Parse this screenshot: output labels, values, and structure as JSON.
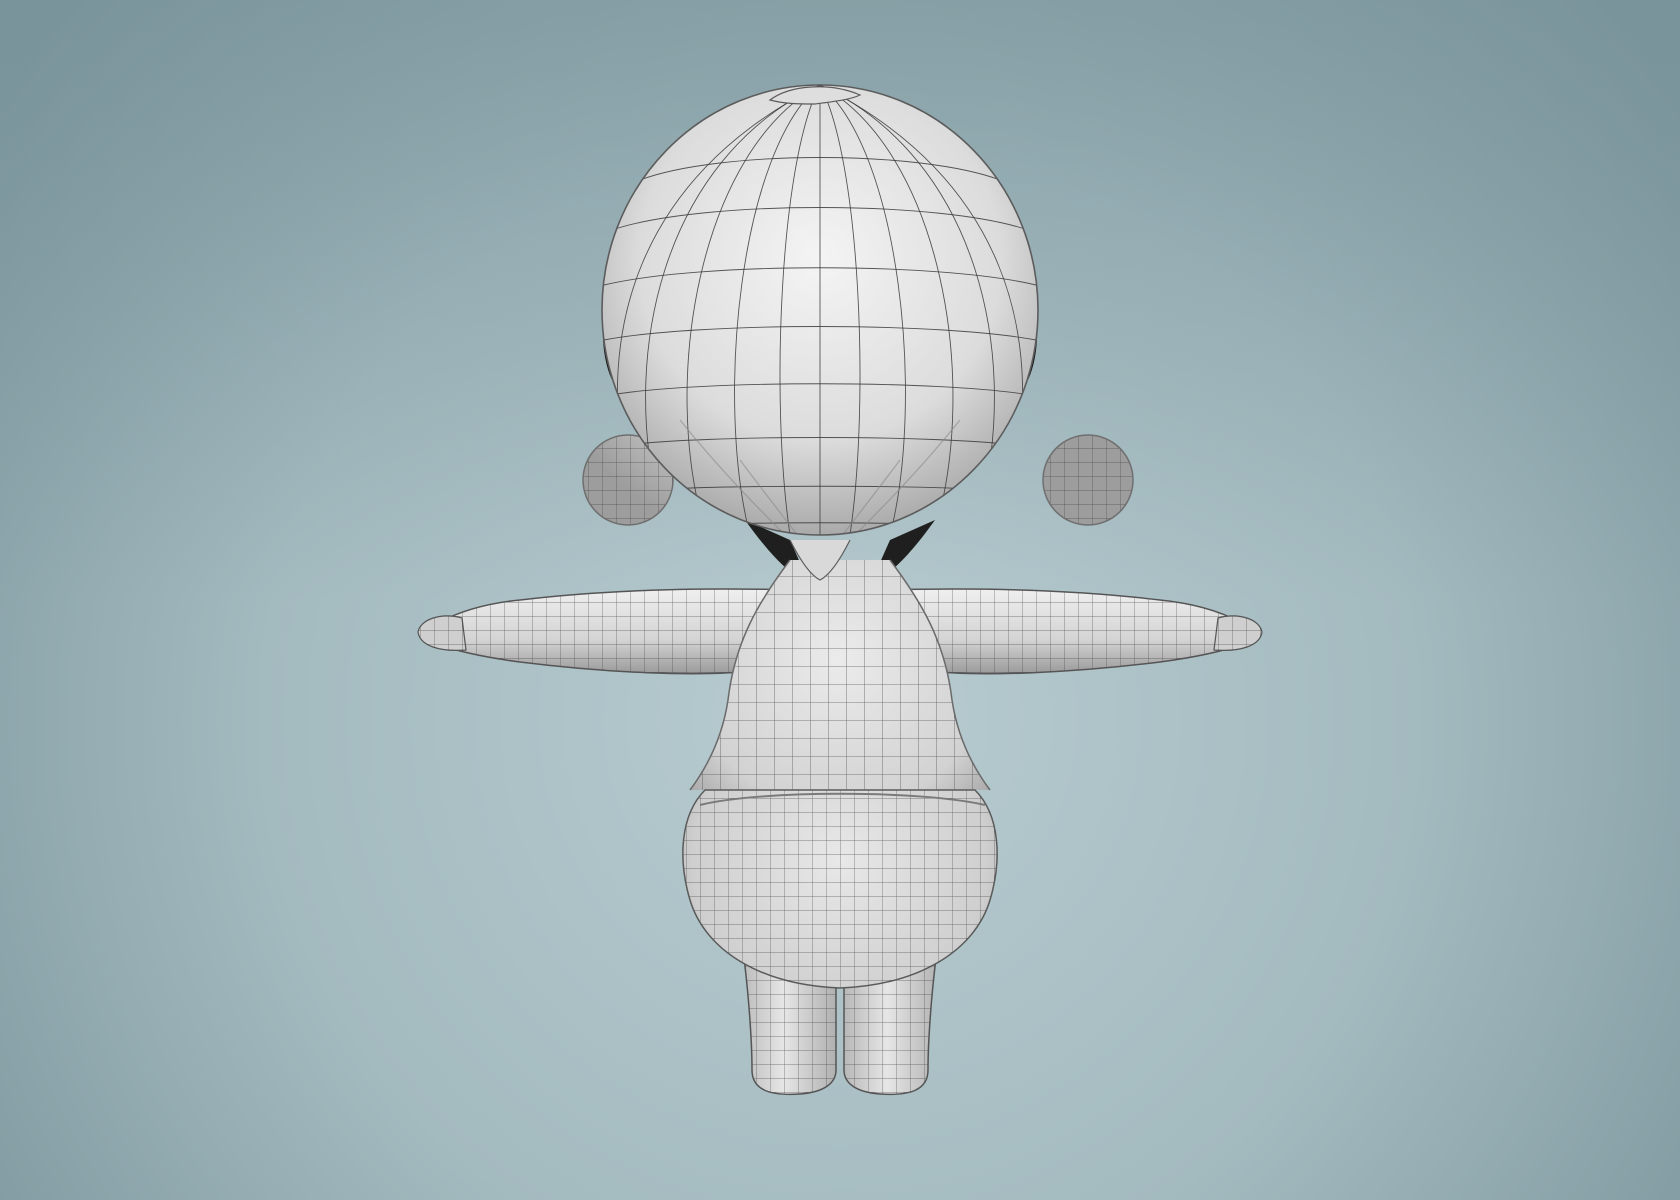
{
  "viewport": {
    "background_top": "#7f9aa1",
    "background_center": "#b4c9ce",
    "background_edge": "#84a0a6",
    "model_fill": "#d8d8d8",
    "model_highlight": "#f2f2f2",
    "model_shadow": "#8e8e8e",
    "wire_color": "#2b2b2b",
    "dark_hair_color": "#1e1e1e"
  },
  "model": {
    "kind": "wireframe-character",
    "pose": "t-pose",
    "view": "back"
  }
}
